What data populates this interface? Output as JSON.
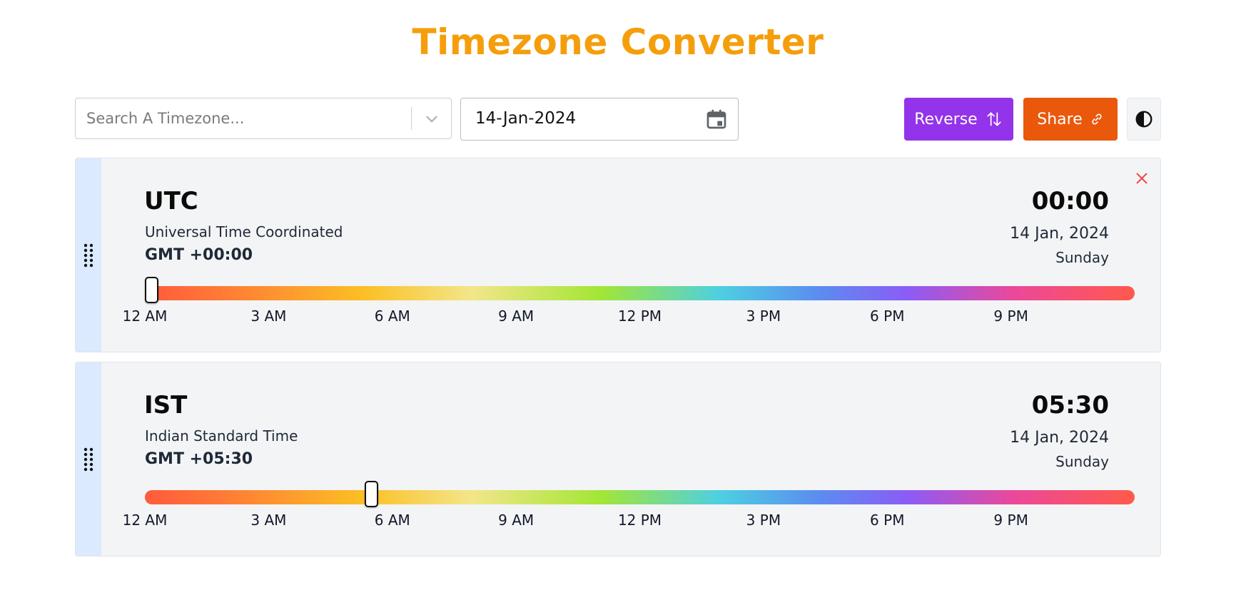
{
  "title": "Timezone Converter",
  "toolbar": {
    "search_placeholder": "Search A Timezone...",
    "date_value": "14-Jan-2024",
    "reverse_label": "Reverse",
    "share_label": "Share",
    "icons": {
      "search_dropdown": "chevron-down-icon",
      "date": "calendar-icon",
      "reverse": "swap-vertical-icon",
      "share": "link-icon",
      "theme": "contrast-icon"
    }
  },
  "colors": {
    "title": "#f59e0b",
    "reverse_button": "#9333ea",
    "share_button": "#ea580c",
    "close_icon": "#ef4444",
    "drag_strip": "#dbeafe"
  },
  "tick_labels": [
    "12 AM",
    "3 AM",
    "6 AM",
    "9 AM",
    "12 PM",
    "3 PM",
    "6 PM",
    "9 PM"
  ],
  "timezones": [
    {
      "abbr": "UTC",
      "name": "Universal Time Coordinated",
      "offset": "GMT +00:00",
      "time": "00:00",
      "date": "14 Jan, 2024",
      "day": "Sunday",
      "slider_hours": 0,
      "closable": true
    },
    {
      "abbr": "IST",
      "name": "Indian Standard Time",
      "offset": "GMT +05:30",
      "time": "05:30",
      "date": "14 Jan, 2024",
      "day": "Sunday",
      "slider_hours": 5.5,
      "closable": false
    }
  ]
}
